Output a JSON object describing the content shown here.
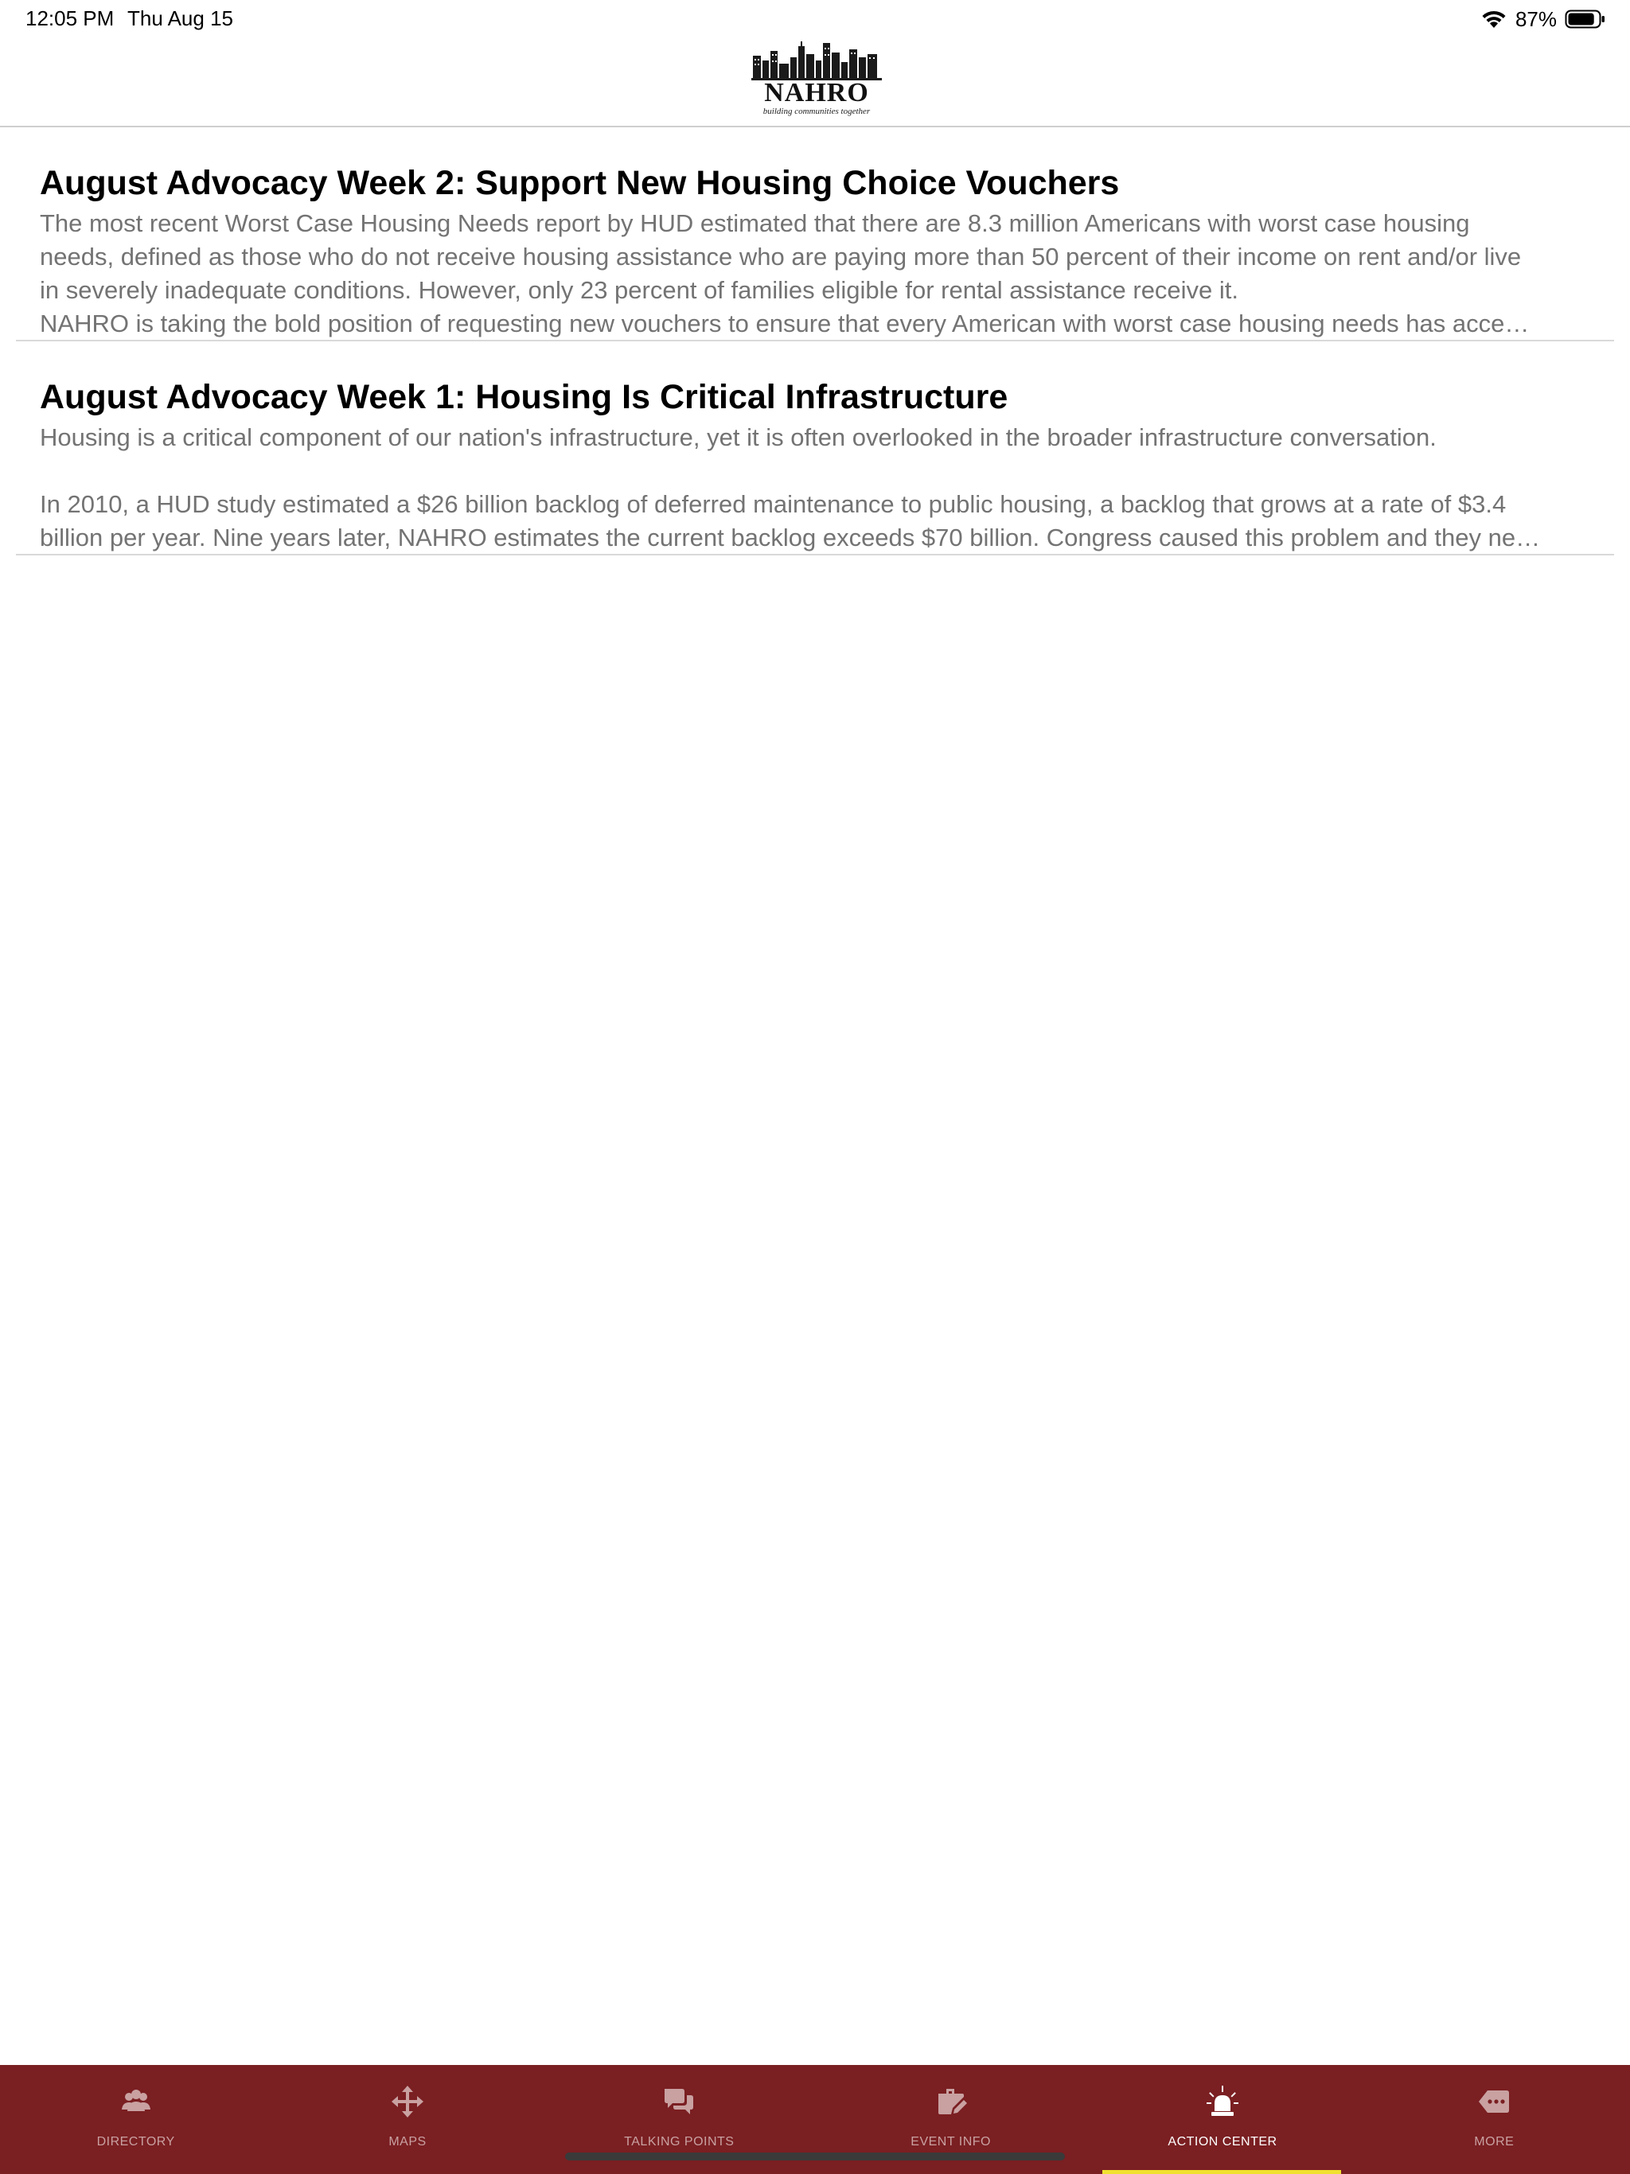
{
  "status_bar": {
    "time": "12:05 PM",
    "date": "Thu Aug 15",
    "battery_percent": "87%",
    "battery_level": 0.87
  },
  "header": {
    "logo_text": "NAHRO",
    "logo_tagline": "building communities together"
  },
  "articles": [
    {
      "title": "August Advocacy Week 2: Support New Housing Choice Vouchers",
      "summary_lines": [
        "The most recent Worst Case Housing Needs report by HUD estimated that there are 8.3 million Americans with worst case housing",
        "needs, defined as those who do not receive housing assistance who are paying more than 50 percent of their income on rent and/or live",
        "in severely inadequate conditions. However, only 23 percent of families eligible for rental assistance receive it.",
        "NAHRO is taking the bold position of requesting new vouchers to ensure that every American with worst case housing needs has acce…"
      ]
    },
    {
      "title": "August Advocacy Week 1: Housing Is Critical Infrastructure",
      "summary_lines": [
        "Housing is a critical component of our nation's infrastructure, yet it is often overlooked in the broader infrastructure conversation.",
        "",
        "In 2010, a HUD study estimated a $26 billion backlog of deferred maintenance to public housing, a backlog that grows at a rate of $3.4",
        "billion per year. Nine years later, NAHRO estimates the current backlog exceeds $70 billion.  Congress caused this problem and they ne…"
      ]
    }
  ],
  "tab_bar": {
    "active_tab": "ACTION CENTER",
    "tabs": [
      {
        "label": "DIRECTORY",
        "icon": "people-icon"
      },
      {
        "label": "MAPS",
        "icon": "move-arrows-icon"
      },
      {
        "label": "TALKING POINTS",
        "icon": "chat-bubbles-icon"
      },
      {
        "label": "EVENT INFO",
        "icon": "briefcase-edit-icon"
      },
      {
        "label": "ACTION CENTER",
        "icon": "alarm-light-icon"
      },
      {
        "label": "MORE",
        "icon": "more-tag-icon"
      }
    ]
  },
  "colors": {
    "tab_bar_background": "#7a1f22",
    "tab_inactive": "#c9a1a1",
    "tab_active": "#ffffff",
    "active_indicator": "#f0e130",
    "summary_text": "#737373"
  }
}
